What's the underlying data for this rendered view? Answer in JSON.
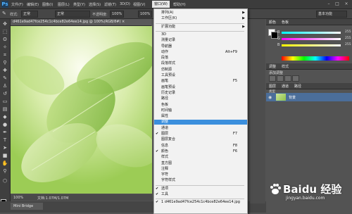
{
  "app": {
    "logo": "Ps"
  },
  "menubar": {
    "items": [
      "文件(F)",
      "编辑(E)",
      "图像(I)",
      "图层(L)",
      "类型(Y)",
      "选择(S)",
      "滤镜(T)",
      "3D(D)",
      "视图(V)",
      "窗口(W)",
      "帮助(H)"
    ],
    "active_index": 9,
    "window_controls": [
      "–",
      "□",
      "×"
    ]
  },
  "options": {
    "style_label": "样式:",
    "style_value": "正常",
    "mode_value": "正常",
    "opacity_label": "不透明度:",
    "opacity_value": "100%",
    "flow_value": "100%",
    "workspace_value": "基本功能"
  },
  "document": {
    "tab_title": "d461e9ad47fce254c1c4bce82e64ee14.jpg @ 100%(RGB/8#) ×",
    "zoom": "100%",
    "status_text": "文档:1.07M/1.07M",
    "mini_bridge": "Mini Bridge"
  },
  "window_menu": {
    "items": [
      {
        "label": "排列(A)",
        "submenu": true
      },
      {
        "label": "工作区(K)",
        "submenu": true
      },
      {
        "separator": true
      },
      {
        "label": "扩展功能",
        "submenu": true
      },
      {
        "separator": true
      },
      {
        "label": "3D"
      },
      {
        "label": "测量记录"
      },
      {
        "label": "导航器"
      },
      {
        "label": "动作",
        "shortcut": "Alt+F9"
      },
      {
        "label": "段落"
      },
      {
        "label": "段落样式"
      },
      {
        "label": "仿制源"
      },
      {
        "label": "工具预设"
      },
      {
        "label": "画笔",
        "shortcut": "F5"
      },
      {
        "label": "画笔预设"
      },
      {
        "label": "历史记录"
      },
      {
        "label": "路径"
      },
      {
        "label": "色板"
      },
      {
        "label": "时间轴"
      },
      {
        "label": "属性"
      },
      {
        "label": "调整",
        "highlight": true
      },
      {
        "label": "通道"
      },
      {
        "label": "图层",
        "shortcut": "F7",
        "checked": true
      },
      {
        "label": "图层复合"
      },
      {
        "label": "信息",
        "shortcut": "F8"
      },
      {
        "label": "颜色",
        "shortcut": "F6",
        "checked": true
      },
      {
        "label": "样式"
      },
      {
        "label": "直方图"
      },
      {
        "label": "注释"
      },
      {
        "label": "字符"
      },
      {
        "label": "字符样式"
      },
      {
        "separator": true
      },
      {
        "label": "选项",
        "checked": true
      },
      {
        "label": "工具",
        "checked": true
      },
      {
        "separator": true
      },
      {
        "label": "1 d461e9ad47fce254c1c4bce82e64ee14.jpg",
        "checked": true
      }
    ]
  },
  "panels": {
    "color_tabs": [
      "颜色",
      "色板"
    ],
    "channels": [
      {
        "label": "R",
        "value": "255",
        "color": "#ff3b3b"
      },
      {
        "label": "G",
        "value": "255",
        "color": "#3bd13b"
      },
      {
        "label": "B",
        "value": "255",
        "color": "#4a6bff"
      }
    ],
    "adjust_tabs": [
      "调整",
      "样式"
    ],
    "adjust_title": "添加调整",
    "layers_tabs": [
      "图层",
      "通道",
      "路径"
    ],
    "layer_kind": "类型",
    "blend_mode": "正常",
    "opacity_label": "不透明度:",
    "layer_name": "背景"
  },
  "watermark": {
    "text": "Baidu 经验",
    "sub": "jingyan.baidu.com"
  }
}
